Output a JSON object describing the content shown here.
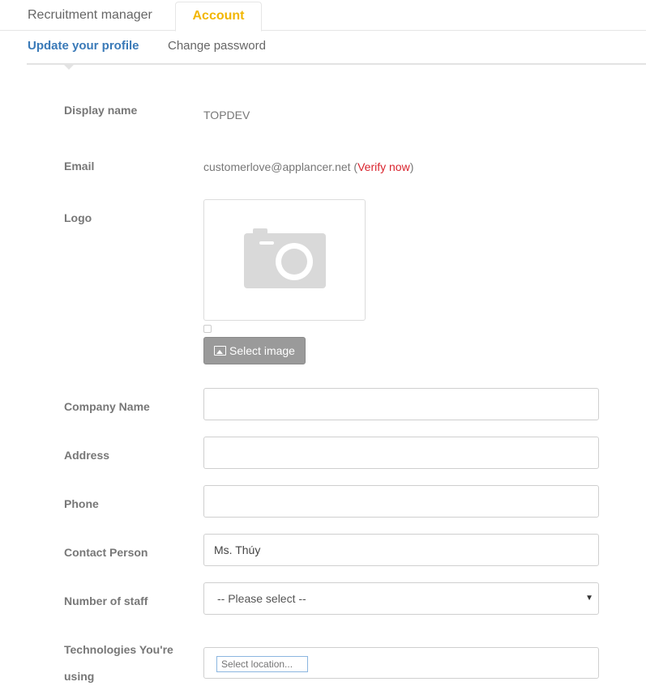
{
  "tabs": {
    "recruitment_manager": "Recruitment manager",
    "account": "Account"
  },
  "subnav": {
    "update_profile": "Update your profile",
    "change_password": "Change password"
  },
  "form": {
    "display_name": {
      "label": "Display name",
      "value": "TOPDEV"
    },
    "email": {
      "label": "Email",
      "value": "customerlove@applancer.net",
      "paren_open": " (",
      "verify_link": "Verify now",
      "paren_close": ")"
    },
    "logo": {
      "label": "Logo",
      "icon": "camera-icon",
      "button": "Select image"
    },
    "company_name": {
      "label": "Company Name",
      "value": ""
    },
    "address": {
      "label": "Address",
      "value": ""
    },
    "phone": {
      "label": "Phone",
      "value": ""
    },
    "contact_person": {
      "label": "Contact Person",
      "value": "Ms. Thúy"
    },
    "number_of_staff": {
      "label": "Number of staff",
      "selected": "-- Please select --"
    },
    "technologies": {
      "label_line1": "Technologies You're",
      "label_line2": "using",
      "placeholder": "Select location..."
    }
  },
  "colors": {
    "accent_tab": "#f2b600",
    "active_link": "#3a7ab8",
    "verify": "#d9232d",
    "button_bg": "#9a9a9a"
  }
}
